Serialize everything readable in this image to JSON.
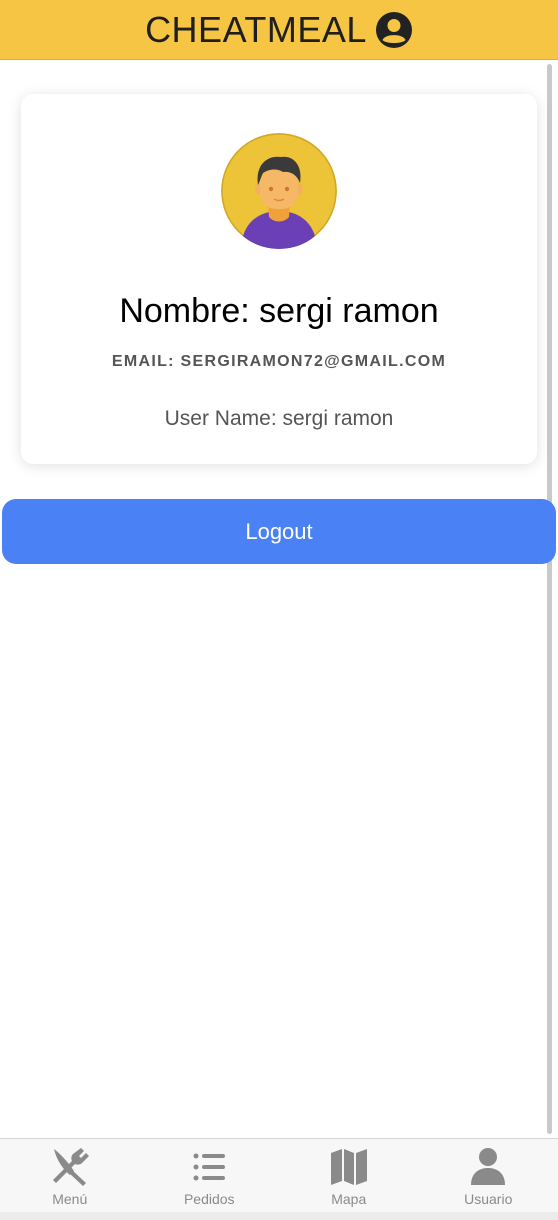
{
  "header": {
    "title": "CHEATMEAL",
    "icon": "user-circle-icon",
    "color": "#f6c544"
  },
  "profile": {
    "avatar": "person-avatar",
    "name": "Nombre: sergi ramon",
    "email": "EMAIL: SERGIRAMON72@GMAIL.COM",
    "username": "User Name: sergi ramon"
  },
  "logout": {
    "label": "Logout",
    "color": "#4a82f6"
  },
  "tabs": [
    {
      "label": "Menú",
      "icon": "fork-knife-icon"
    },
    {
      "label": "Pedidos",
      "icon": "list-icon"
    },
    {
      "label": "Mapa",
      "icon": "map-icon"
    },
    {
      "label": "Usuario",
      "icon": "user-icon"
    }
  ]
}
